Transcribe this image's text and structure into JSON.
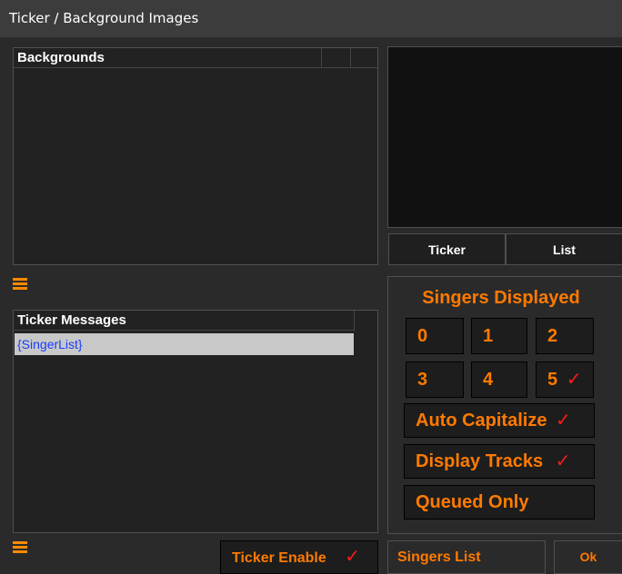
{
  "window": {
    "title": "Ticker / Background Images"
  },
  "backgrounds": {
    "header": "Backgrounds"
  },
  "ticker_messages": {
    "header": "Ticker Messages",
    "items": [
      "{SingerList}"
    ]
  },
  "preview_tabs": {
    "ticker": "Ticker",
    "list": "List"
  },
  "singers_displayed": {
    "title": "Singers Displayed",
    "options": [
      "0",
      "1",
      "2",
      "3",
      "4",
      "5"
    ],
    "selected": "5",
    "check": "✓"
  },
  "options": {
    "auto_capitalize": {
      "label": "Auto Capitalize",
      "check": "✓"
    },
    "display_tracks": {
      "label": "Display Tracks",
      "check": "✓"
    },
    "queued_only": {
      "label": "Queued Only"
    }
  },
  "footer": {
    "ticker_enable": {
      "label": "Ticker Enable",
      "check": "✓"
    },
    "singers_list": "Singers List",
    "ok": "Ok"
  },
  "colors": {
    "accent": "#ff7a00",
    "check": "#ff1a1a",
    "link": "#1a3cff"
  }
}
